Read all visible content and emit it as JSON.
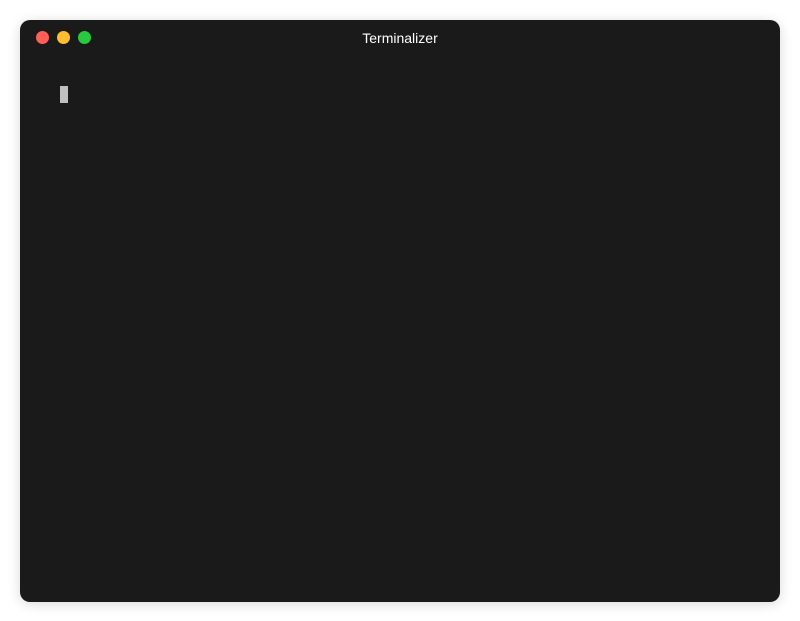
{
  "window": {
    "title": "Terminalizer"
  },
  "terminal": {
    "prompt": "",
    "cursor_visible": true
  },
  "colors": {
    "background": "#1a1a1a",
    "close": "#ff5f56",
    "minimize": "#ffbd2e",
    "maximize": "#27c93f",
    "cursor": "#bfbfbf"
  }
}
